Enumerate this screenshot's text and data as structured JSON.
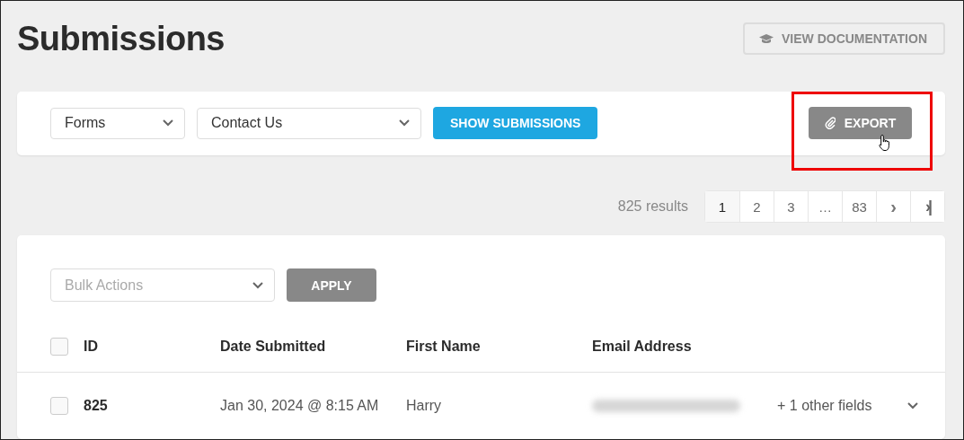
{
  "page": {
    "title": "Submissions"
  },
  "doc_button": {
    "label": "VIEW DOCUMENTATION"
  },
  "filters": {
    "dropdowns": [
      {
        "value": "Forms"
      },
      {
        "value": "Contact Us"
      }
    ],
    "show_button": {
      "label": "SHOW SUBMISSIONS"
    },
    "export_button": {
      "label": "EXPORT",
      "highlighted": true,
      "hovered": true
    }
  },
  "results": "825 results",
  "pagination": [
    {
      "label": "1",
      "selected": true
    },
    {
      "label": "2",
      "selected": false
    },
    {
      "label": "3",
      "selected": false
    },
    {
      "label": "…",
      "selected": false
    },
    {
      "label": "83",
      "selected": false
    },
    {
      "label": "›",
      "selected": false,
      "kind": "next"
    },
    {
      "label": "›|",
      "selected": false,
      "kind": "last"
    }
  ],
  "bulk": {
    "placeholder": "Bulk Actions",
    "apply": "APPLY"
  },
  "table": {
    "columns": [
      "ID",
      "Date Submitted",
      "First Name",
      "Email Address"
    ],
    "header_checked": false,
    "rows": [
      {
        "checked": false,
        "cells": [
          {
            "text": "825"
          },
          {
            "text": "Jan 30, 2024 @ 8:15 AM"
          },
          {
            "text": "Harry"
          },
          {
            "kind": "blurred"
          }
        ],
        "more": "+ 1 other fields",
        "expanded": false
      }
    ]
  }
}
